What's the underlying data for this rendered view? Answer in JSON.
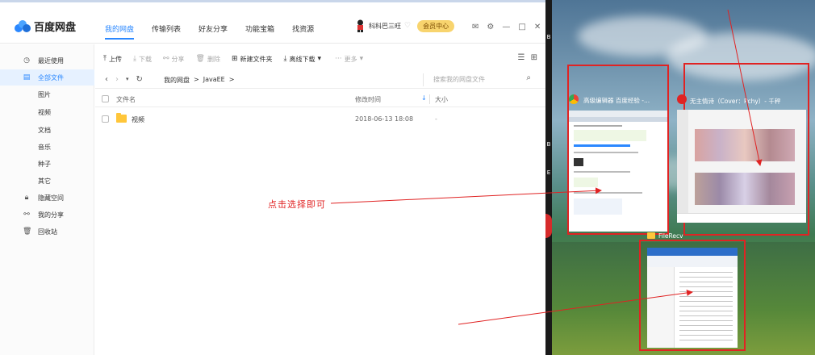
{
  "app": {
    "title": "百度网盘",
    "nav_tabs": [
      "我的网盘",
      "传输列表",
      "好友分享",
      "功能宝箱",
      "找资源"
    ],
    "username": "科科巴三旺",
    "vip_label": "会员中心"
  },
  "sidebar": {
    "items": [
      {
        "label": "最近使用"
      },
      {
        "label": "全部文件"
      },
      {
        "label": "图片"
      },
      {
        "label": "视频"
      },
      {
        "label": "文档"
      },
      {
        "label": "音乐"
      },
      {
        "label": "种子"
      },
      {
        "label": "其它"
      },
      {
        "label": "隐藏空间"
      },
      {
        "label": "我的分享"
      },
      {
        "label": "回收站"
      }
    ]
  },
  "toolbar": {
    "upload": "上传",
    "download": "下载",
    "share": "分享",
    "delete": "删除",
    "new_folder": "新建文件夹",
    "offline_download": "离线下载",
    "more": "更多"
  },
  "address": {
    "crumbs": [
      "我的网盘",
      ">",
      "JavaEE",
      ">"
    ],
    "search_placeholder": "搜索我的网盘文件"
  },
  "table": {
    "headers": {
      "name": "文件名",
      "modified": "修改时间",
      "size": "大小"
    },
    "rows": [
      {
        "name": "视频",
        "modified": "2018-06-13 18:08",
        "size": "-"
      }
    ]
  },
  "taskview": {
    "window1_title": "高级编辑器 百度经验 -...",
    "window2_title": "无主情诗（Cover：Pchy）- 千秤",
    "window3_title": "FileRecv"
  },
  "annotation": {
    "text": "点击选择即可",
    "color": "#e02323"
  },
  "colors": {
    "accent": "#2b88ff",
    "vip": "#f8d46e",
    "folder": "#ffc63a"
  }
}
